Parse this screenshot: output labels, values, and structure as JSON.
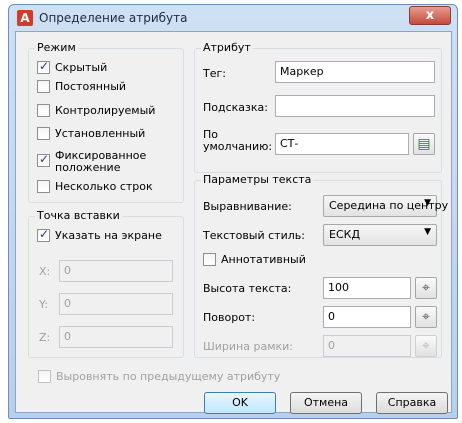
{
  "window": {
    "title": "Определение атрибута",
    "app_icon_letter": "A",
    "close_label": "x",
    "accent_color": "#c44a3b"
  },
  "mode": {
    "legend": "Режим",
    "options": [
      {
        "label": "Скрытый",
        "checked": true
      },
      {
        "label": "Постоянный",
        "checked": false
      },
      {
        "label": "Контролируемый",
        "checked": false
      },
      {
        "label": "Установленный",
        "checked": false
      },
      {
        "label": "Фиксированное",
        "label2": "положение",
        "checked": true
      },
      {
        "label": "Несколько строк",
        "checked": false
      }
    ]
  },
  "insertion": {
    "legend": "Точка вставки",
    "on_screen_label": "Указать на экране",
    "on_screen_checked": true,
    "x_label": "X:",
    "x_value": "0",
    "y_label": "Y:",
    "y_value": "0",
    "z_label": "Z:",
    "z_value": "0"
  },
  "attribute": {
    "legend": "Атрибут",
    "tag_label": "Тег:",
    "tag_value": "Маркер",
    "prompt_label": "Подсказка:",
    "prompt_value": "",
    "default_label_1": "По",
    "default_label_2": "умолчанию:",
    "default_value": "СТ-",
    "field_icon": "insert-field-icon"
  },
  "text": {
    "legend": "Параметры текста",
    "justify_label": "Выравнивание:",
    "justify_value": "Середина по центру",
    "style_label": "Текстовый стиль:",
    "style_value": "ЕСКД",
    "annotative_label": "Аннотативный",
    "annotative_checked": false,
    "height_label": "Высота текста:",
    "height_value": "100",
    "rotation_label": "Поворот:",
    "rotation_value": "0",
    "width_label": "Ширина рамки:",
    "width_value": "0",
    "pick_icon": "pick-point-icon"
  },
  "align_previous_label": "Выровнять по предыдущему атрибуту",
  "buttons": {
    "ok": "OK",
    "cancel": "Отмена",
    "help": "Справка"
  }
}
